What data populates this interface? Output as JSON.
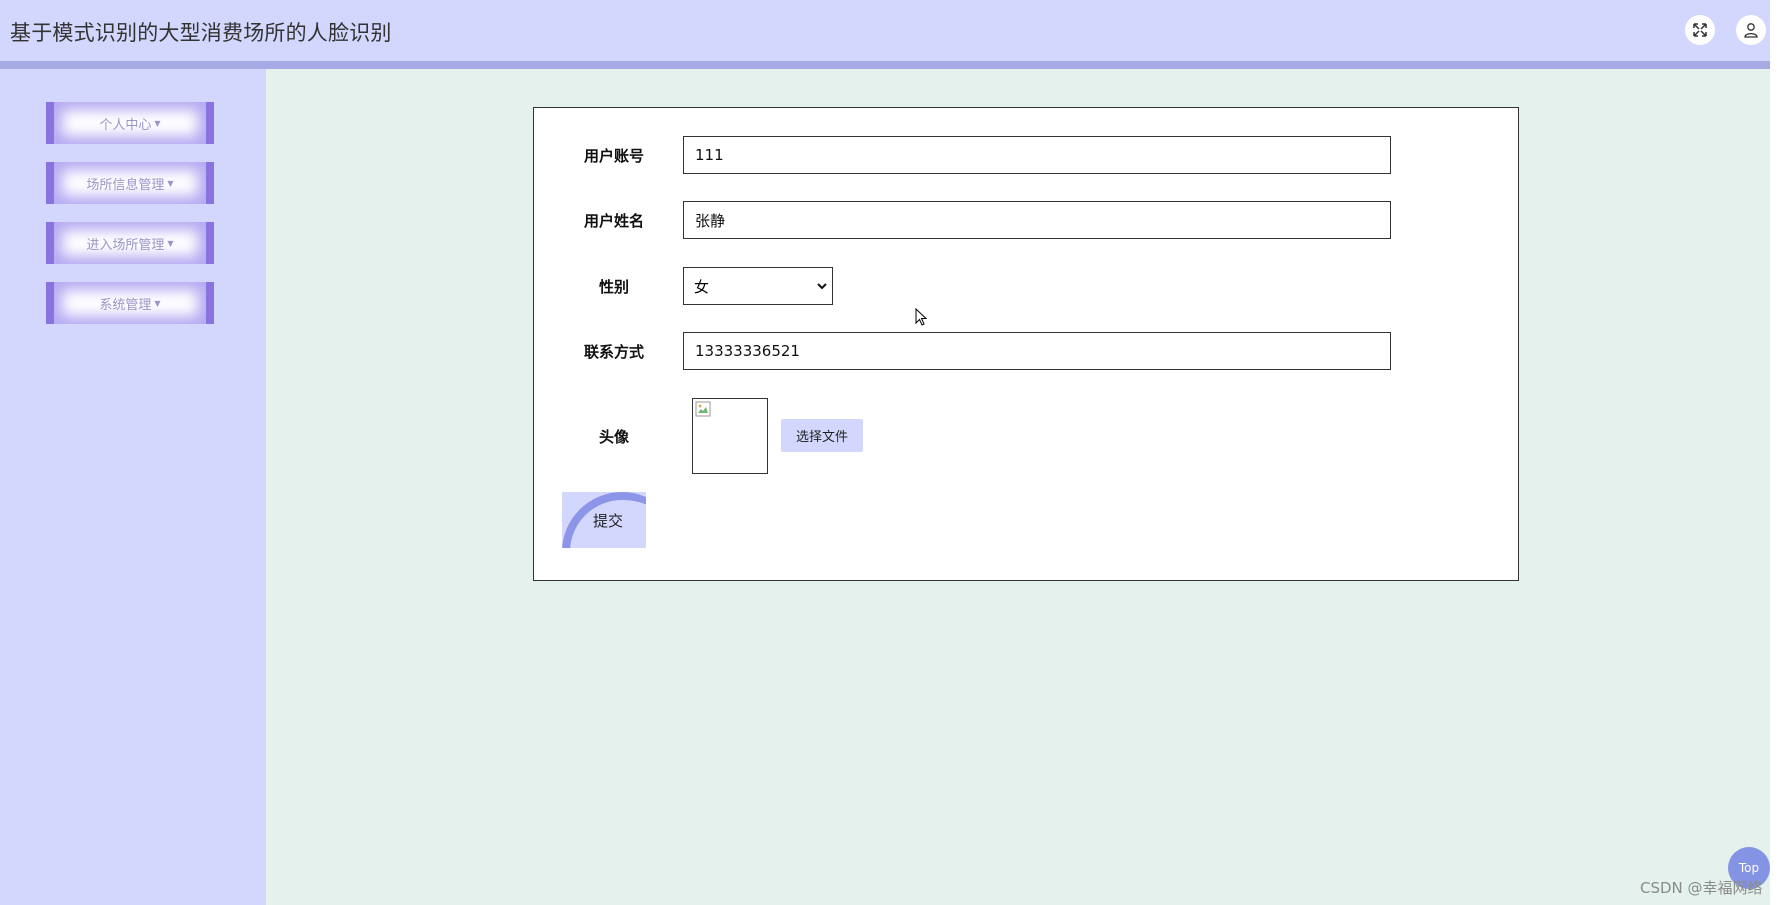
{
  "header": {
    "title": "基于模式识别的大型消费场所的人脸识别",
    "fullscreen_icon": "expand-icon",
    "user_icon": "user-icon"
  },
  "sidebar": {
    "items": [
      {
        "label": "个人中心"
      },
      {
        "label": "场所信息管理"
      },
      {
        "label": "进入场所管理"
      },
      {
        "label": "系统管理"
      }
    ]
  },
  "form": {
    "account": {
      "label": "用户账号",
      "value": "111"
    },
    "name": {
      "label": "用户姓名",
      "value": "张静"
    },
    "gender": {
      "label": "性别",
      "value": "女"
    },
    "phone": {
      "label": "联系方式",
      "value": "13333336521"
    },
    "avatar": {
      "label": "头像",
      "choose_file": "选择文件"
    },
    "submit": "提交"
  },
  "top_button": "Top",
  "watermark": "CSDN @幸福网络",
  "colors": {
    "header_bg": "#d3d7fd",
    "main_bg": "#e4f1ec",
    "accent": "#8a72e0"
  }
}
